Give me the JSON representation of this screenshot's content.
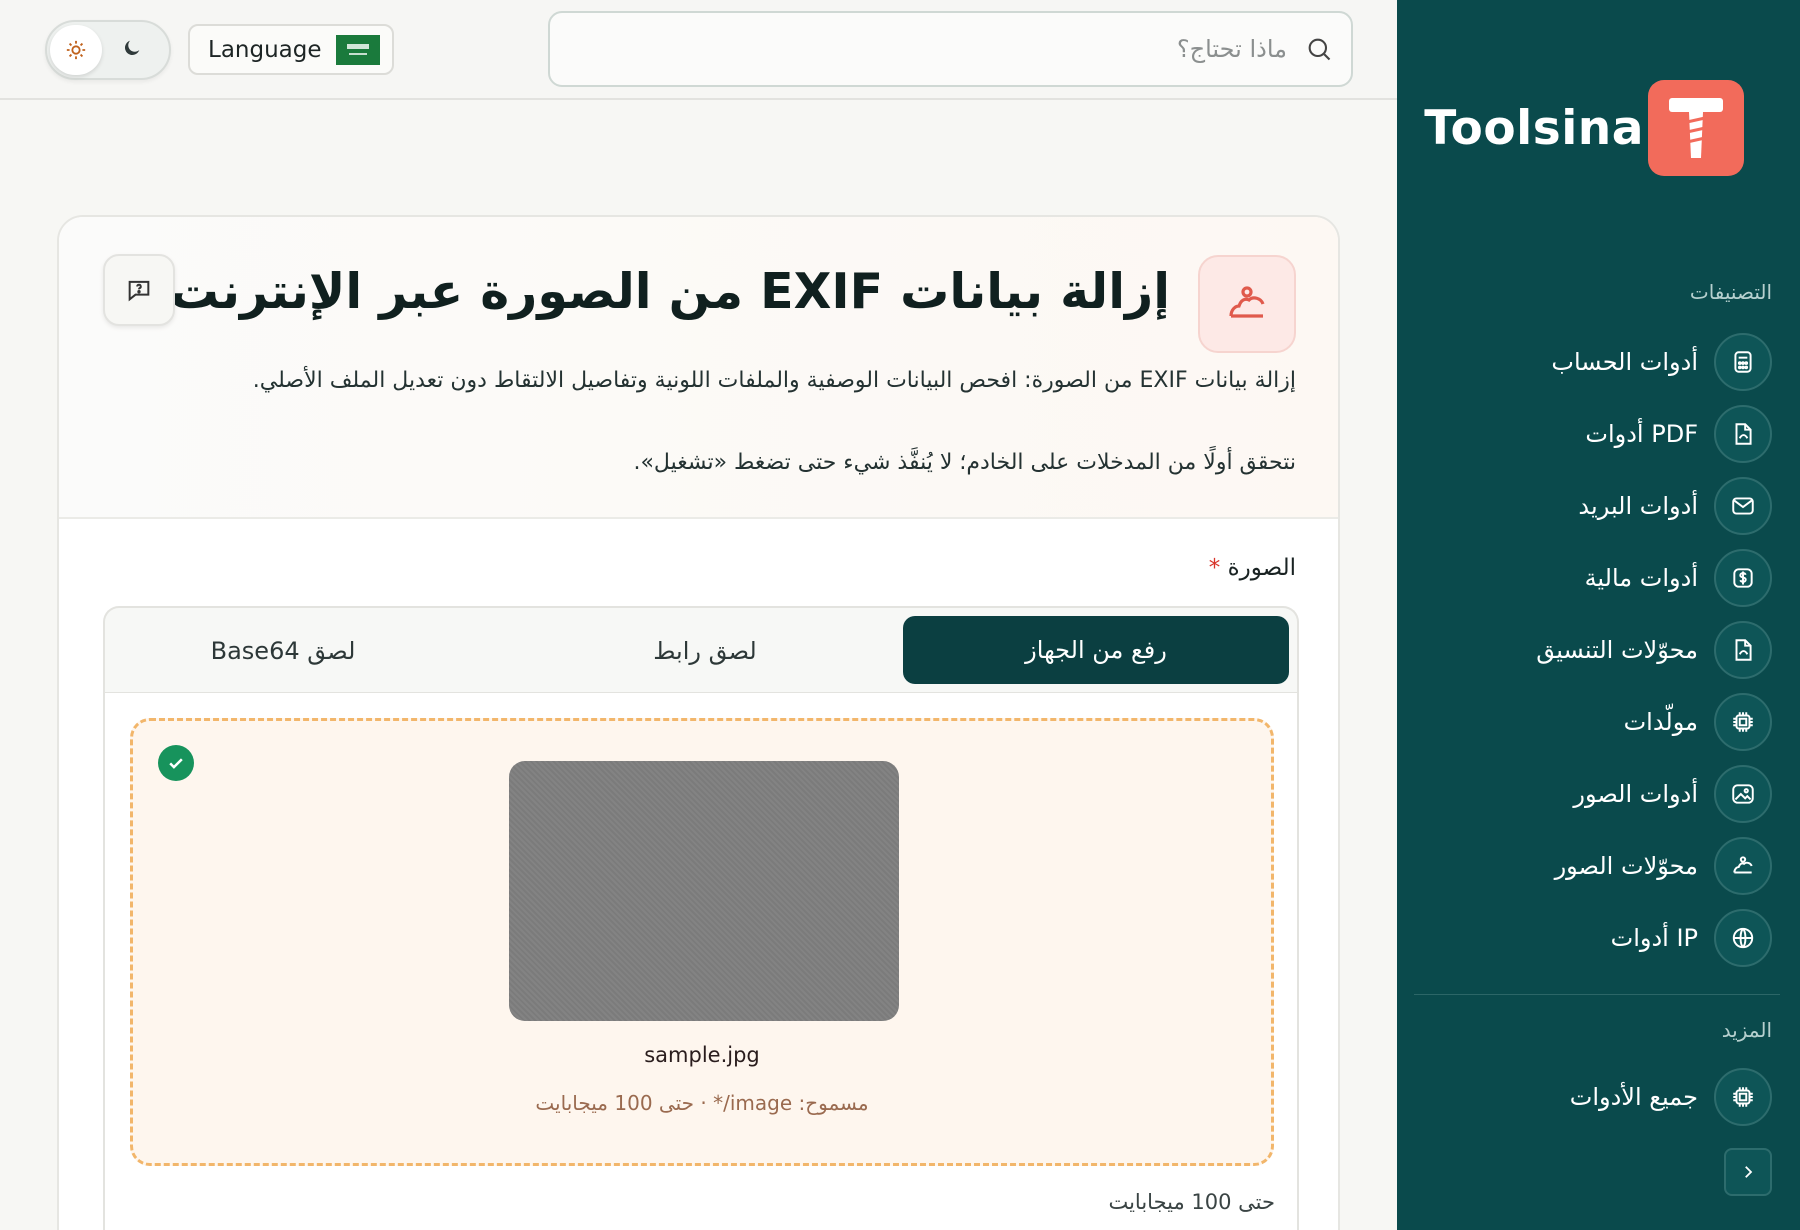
{
  "topbar": {
    "search_placeholder": "ماذا تحتاج؟",
    "language_label": "Language",
    "theme": {
      "light_icon": "sun-icon",
      "dark_icon": "moon-icon",
      "active": "light"
    }
  },
  "brand": {
    "name": "Toolsina",
    "accent": "#f26b5b"
  },
  "sidebar": {
    "categories_heading": "التصنيفات",
    "items": [
      {
        "label": "أدوات الحساب",
        "icon": "calculator-icon"
      },
      {
        "label": "أدوات PDF",
        "icon": "file-icon"
      },
      {
        "label": "أدوات البريد",
        "icon": "mail-icon"
      },
      {
        "label": "أدوات مالية",
        "icon": "dollar-icon"
      },
      {
        "label": "محوّلات التنسيق",
        "icon": "file-convert-icon"
      },
      {
        "label": "مولّدات",
        "icon": "chip-icon"
      },
      {
        "label": "أدوات الصور",
        "icon": "image-icon"
      },
      {
        "label": "محوّلات الصور",
        "icon": "image-convert-icon"
      },
      {
        "label": "أدوات IP",
        "icon": "globe-icon"
      }
    ],
    "more_heading": "المزيد",
    "more_items": [
      {
        "label": "جميع الأدوات",
        "icon": "chip-icon"
      }
    ],
    "bg_color": "#0a4a4c"
  },
  "tool": {
    "title": "إزالة بيانات EXIF من الصورة عبر الإنترنت",
    "description": "إزالة بيانات EXIF من الصورة: افحص البيانات الوصفية والملفات اللونية وتفاصيل الالتقاط دون تعديل الملف الأصلي.",
    "note": "نتحقق أولًا من المدخلات على الخادم؛ لا يُنفَّذ شيء حتى تضغط «تشغيل».",
    "field_label": "الصورة",
    "required_mark": "*",
    "tabs": [
      "رفع من الجهاز",
      "لصق رابط",
      "لصق Base64"
    ],
    "active_tab": "رفع من الجهاز",
    "file_name": "sample.jpg",
    "allowed_text": "مسموح: image/* · حتى 100 ميجابايت",
    "limit_text": "حتى 100 ميجابايت"
  }
}
